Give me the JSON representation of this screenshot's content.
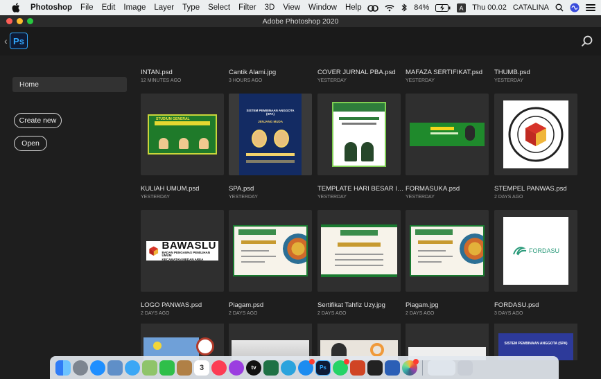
{
  "menubar": {
    "app_name": "Photoshop",
    "menus": [
      "File",
      "Edit",
      "Image",
      "Layer",
      "Type",
      "Select",
      "Filter",
      "3D",
      "View",
      "Window",
      "Help"
    ],
    "battery": "84%",
    "clock": "Thu 00.02",
    "user": "CATALINA",
    "icons": [
      "apple-icon",
      "creative-cloud-icon",
      "wifi-icon",
      "bluetooth-icon",
      "battery-icon",
      "input-a-icon",
      "spotlight-icon",
      "siri-icon",
      "control-center-icon"
    ]
  },
  "window": {
    "title": "Adobe Photoshop 2020"
  },
  "ps_header": {
    "logo": "Ps"
  },
  "sidebar": {
    "home_label": "Home",
    "create_new_label": "Create new",
    "open_label": "Open"
  },
  "files": [
    {
      "name": "INTAN.psd",
      "time": "12 MINUTES AGO"
    },
    {
      "name": "Cantik Alami.jpg",
      "time": "3 HOURS AGO"
    },
    {
      "name": "COVER JURNAL PBA.psd",
      "time": "YESTERDAY"
    },
    {
      "name": "MAFAZA SERTIFIKAT.psd",
      "time": "YESTERDAY"
    },
    {
      "name": "THUMB.psd",
      "time": "YESTERDAY"
    },
    {
      "name": "KULIAH UMUM.psd",
      "time": "YESTERDAY"
    },
    {
      "name": "SPA.psd",
      "time": "YESTERDAY"
    },
    {
      "name": "TEMPLATE HARI BESAR ITH...",
      "time": "YESTERDAY"
    },
    {
      "name": "FORMASUKA.psd",
      "time": "YESTERDAY"
    },
    {
      "name": "STEMPEL PANWAS.psd",
      "time": "2 DAYS AGO"
    },
    {
      "name": "LOGO PANWAS.psd",
      "time": "2 DAYS AGO"
    },
    {
      "name": "Piagam.psd",
      "time": "2 DAYS AGO"
    },
    {
      "name": "Sertifikat Tahfiz Uzy.jpg",
      "time": "2 DAYS AGO"
    },
    {
      "name": "Piagam.jpg",
      "time": "2 DAYS AGO"
    },
    {
      "name": "FORDASU.psd",
      "time": "3 DAYS AGO"
    }
  ],
  "thumb_text": {
    "studium": "STUDIUM GENERAL",
    "spa_title": "SISTEM PEMBINAAN ANGGOTA (SPA)",
    "spa_sub": "JENJANG MUDA",
    "bawaslu": "BAWASLU",
    "bawaslu_sub1": "BADAN PENGAWAS PEMILIHAN UMUM",
    "bawaslu_sub2": "KECAMATAN MEDAN AREA",
    "fordasu": "FORDASU",
    "spa_bottom": "SISTEM PEMBINAAN ANGGOTA (SPA)"
  },
  "dock": {
    "apps": [
      "finder-icon",
      "launchpad-icon",
      "safari-icon",
      "preview-icon",
      "messages-icon",
      "maps-icon",
      "facetime-icon",
      "notes-icon",
      "calendar-icon",
      "music-icon",
      "podcasts-icon",
      "tv-icon",
      "excel-icon",
      "telegram-icon",
      "app-store-icon",
      "photoshop-icon",
      "whatsapp-icon",
      "powerpoint-icon",
      "terminal-icon",
      "word-icon",
      "photos-icon",
      "downloads-icon",
      "trash-icon"
    ],
    "calendar_day": "3",
    "tv_label": "tv",
    "ps_label": "Ps"
  },
  "colors": {
    "accent": "#31a8ff",
    "background": "#1e1e1e",
    "tile": "#2f2f2f"
  }
}
